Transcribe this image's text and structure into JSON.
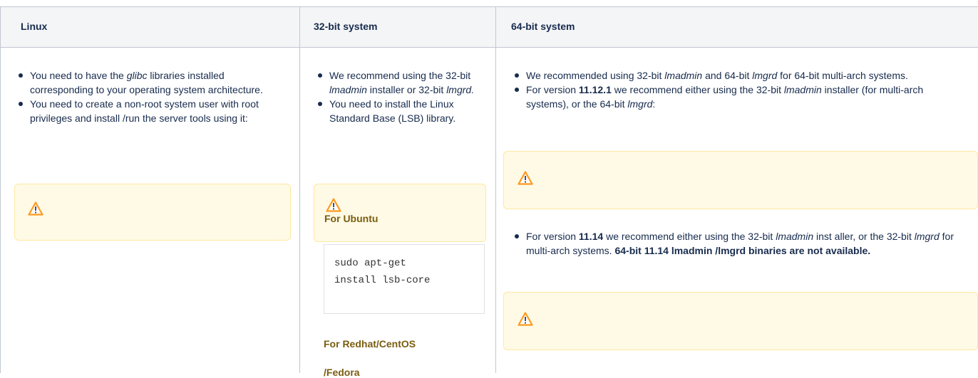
{
  "headers": {
    "linux": "Linux",
    "bit32": "32-bit system",
    "bit64": "64-bit system"
  },
  "linux": {
    "b1_pre": "You need to have the ",
    "b1_em": "glibc",
    "b1_post": " libraries installed corresponding to your operating system architecture.",
    "b2": "You need to create a non-root system user with root privileges and install /run the server tools using it:"
  },
  "bit32": {
    "b1_pre": "We recommend using the 32-bit ",
    "b1_em1": "lmadmin",
    "b1_mid": " installer or 32-bit ",
    "b1_em2": "lmgrd.",
    "b2": "You need to install the Linux Standard Base (LSB) library.",
    "ubuntu_heading": "For Ubuntu",
    "ubuntu_code_1": "sudo apt-get",
    "ubuntu_code_2": "install lsb-core",
    "redhat_heading_1": "For Redhat/CentOS",
    "redhat_heading_2": "/Fedora"
  },
  "bit64": {
    "b1_pre": "We recommended using 32-bit ",
    "b1_em1": "lmadmin",
    "b1_mid": " and 64-bit ",
    "b1_em2": "lmgrd",
    "b1_post": " for 64-bit multi-arch systems.",
    "b2_pre": "For version ",
    "b2_ver": "11.12.1",
    "b2_mid": " we recommend either using the 32-bit ",
    "b2_em1": "lmadmin",
    "b2_mid2": " installer (for multi-arch systems), or the 64-bit ",
    "b2_em2": "lmgrd",
    "b2_post": ":",
    "b3_pre": "For version ",
    "b3_ver": "11.14",
    "b3_mid": " we recommend either using the 32-bit ",
    "b3_em1": "lmadmin",
    "b3_mid2": " inst aller, or the 32-bit ",
    "b3_em2": "lmgrd",
    "b3_mid3": " for multi-arch systems. ",
    "b3_bold": "64-bit 11.14 lmadmin /lmgrd binaries are not available."
  },
  "icons": {
    "warning": "warning-icon"
  },
  "colors": {
    "header_bg": "#f4f5f7",
    "note_bg": "#fffae6",
    "note_border": "#ffe7a3",
    "warning": "#ff991f",
    "heading_olive": "#7a5d10"
  }
}
